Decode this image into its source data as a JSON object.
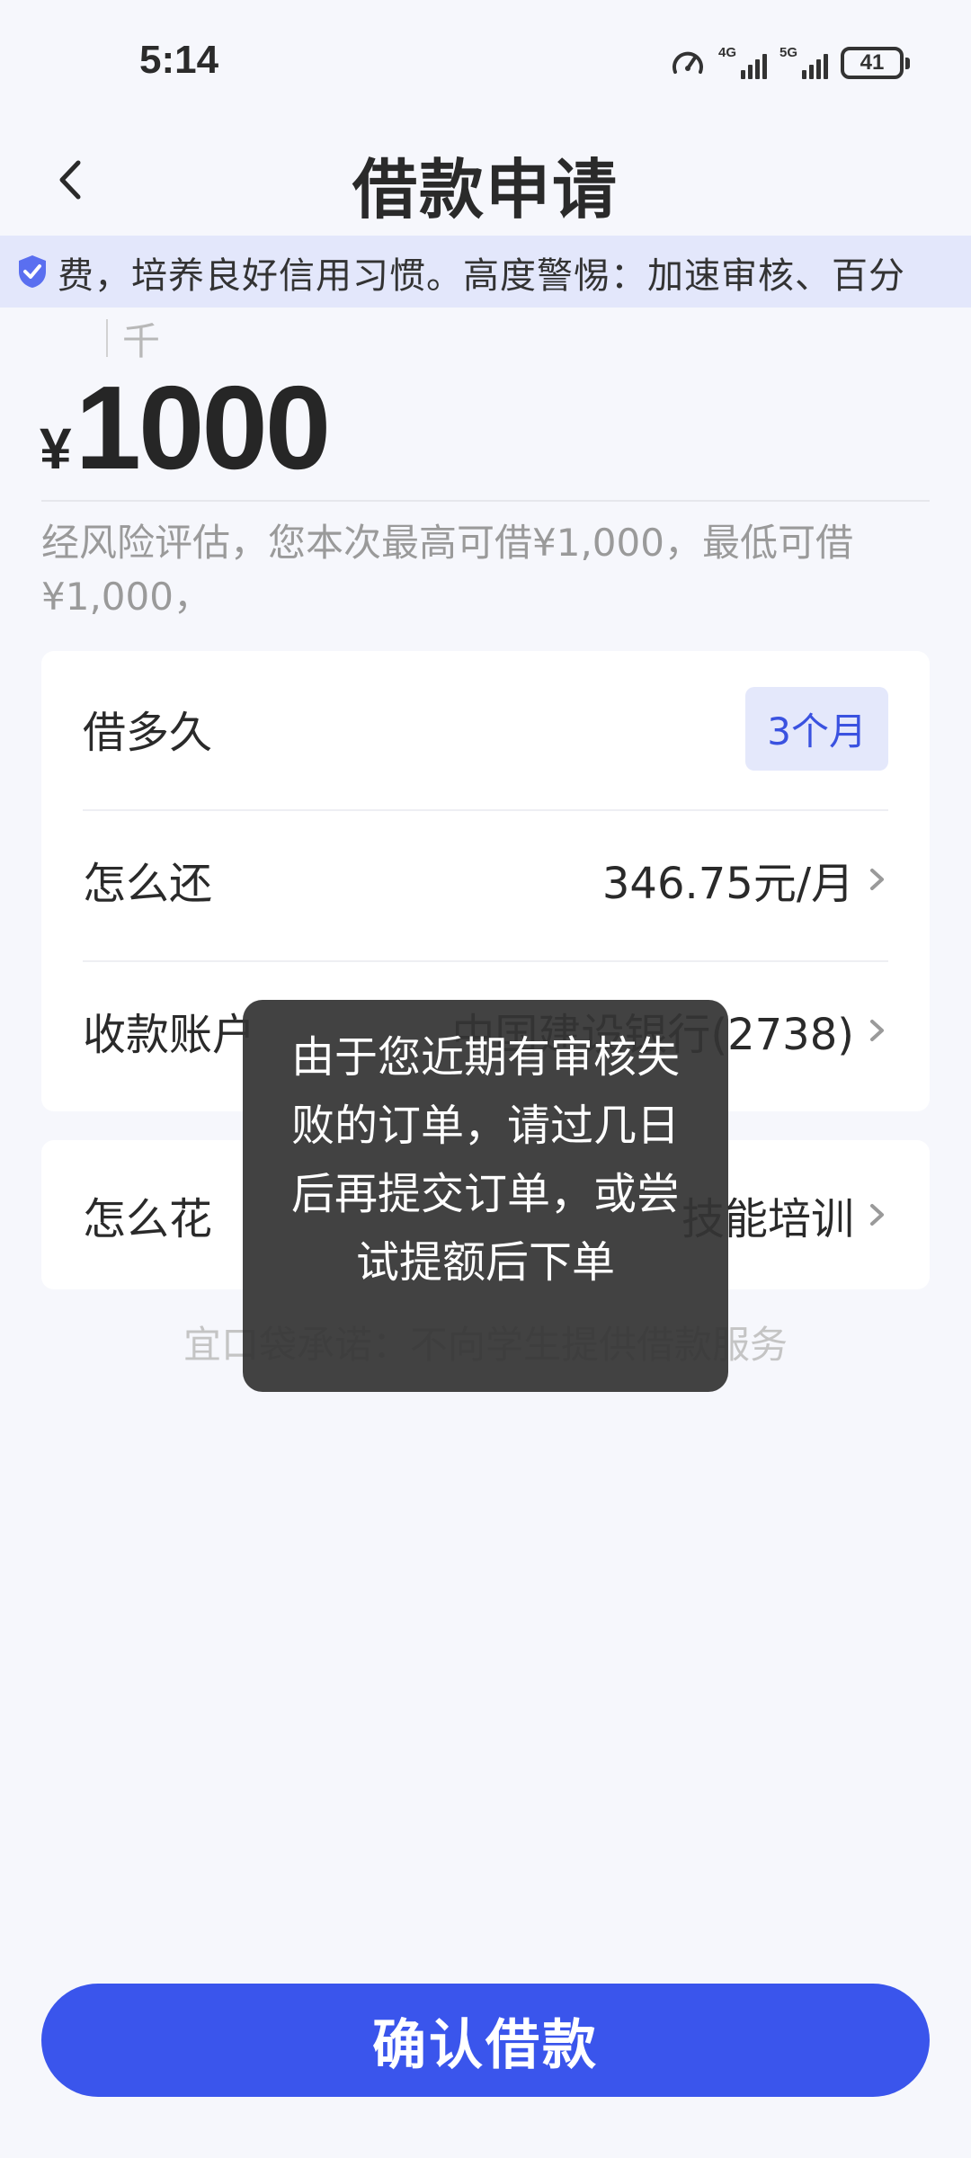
{
  "status_bar": {
    "time": "5:14",
    "network_1": "4G",
    "network_2": "5G",
    "battery": "41"
  },
  "header": {
    "title": "借款申请",
    "back_icon": "chevron-left-icon"
  },
  "notice": {
    "icon": "shield-check-icon",
    "text": "费，培养良好信用习惯。高度警惕：加速审核、百分"
  },
  "amount": {
    "unit_hint": "千",
    "currency": "¥",
    "value": "1000",
    "risk_text": "经风险评估，您本次最高可借¥1,000，最低可借¥1,000，"
  },
  "loan_details": {
    "term_label": "借多久",
    "term_value": "3个月",
    "repay_label": "怎么还",
    "repay_value": "346.75元/月",
    "account_label": "收款账户",
    "account_value": "中国建设银行(2738)"
  },
  "usage": {
    "label": "怎么花",
    "value": "技能培训"
  },
  "promise_text": "宜口袋承诺：不向学生提供借款服务",
  "toast": {
    "message": "由于您近期有审核失败的订单，请过几日后再提交订单，或尝试提额后下单"
  },
  "confirm_button": "确认借款",
  "colors": {
    "accent": "#3a55ec",
    "background": "#f6f7fc",
    "notice_bg": "#e3e7fb",
    "chip_text": "#3a52e0",
    "toast_bg": "#343434"
  }
}
